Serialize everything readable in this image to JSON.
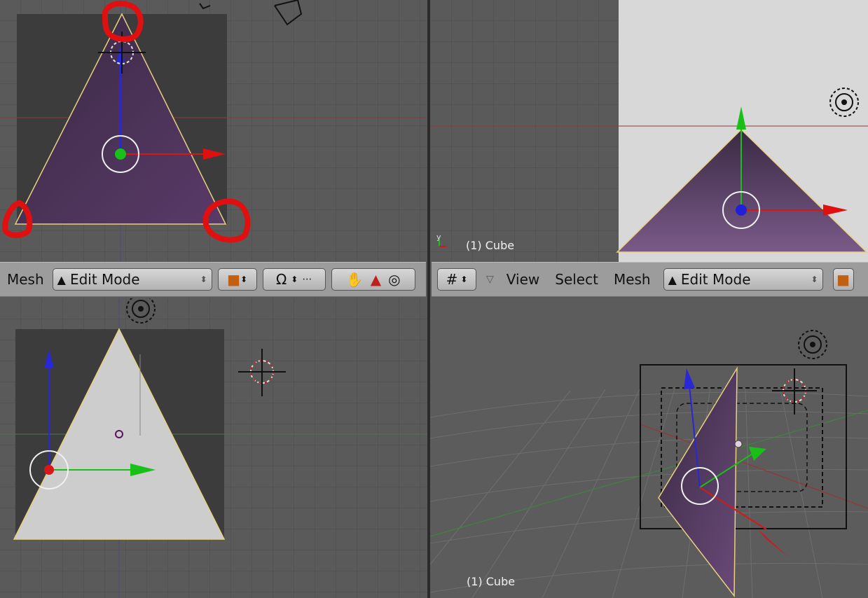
{
  "viewport_top_right": {
    "object_label": "(1) Cube",
    "axis_label": "y"
  },
  "viewport_bottom_right": {
    "object_label": "(1) Cube"
  },
  "header_left": {
    "mesh_label": "Mesh",
    "mode_label": "Edit Mode"
  },
  "header_right": {
    "view_label": "View",
    "select_label": "Select",
    "mesh_label": "Mesh",
    "mode_label": "Edit Mode"
  },
  "colors": {
    "viewport_bg": "#5a5a5a",
    "face_purple": "#4a2f52",
    "face_white": "#cdcdcd",
    "highlight_red": "#e01010",
    "axis_green": "#18c018",
    "axis_blue": "#2020d8"
  }
}
